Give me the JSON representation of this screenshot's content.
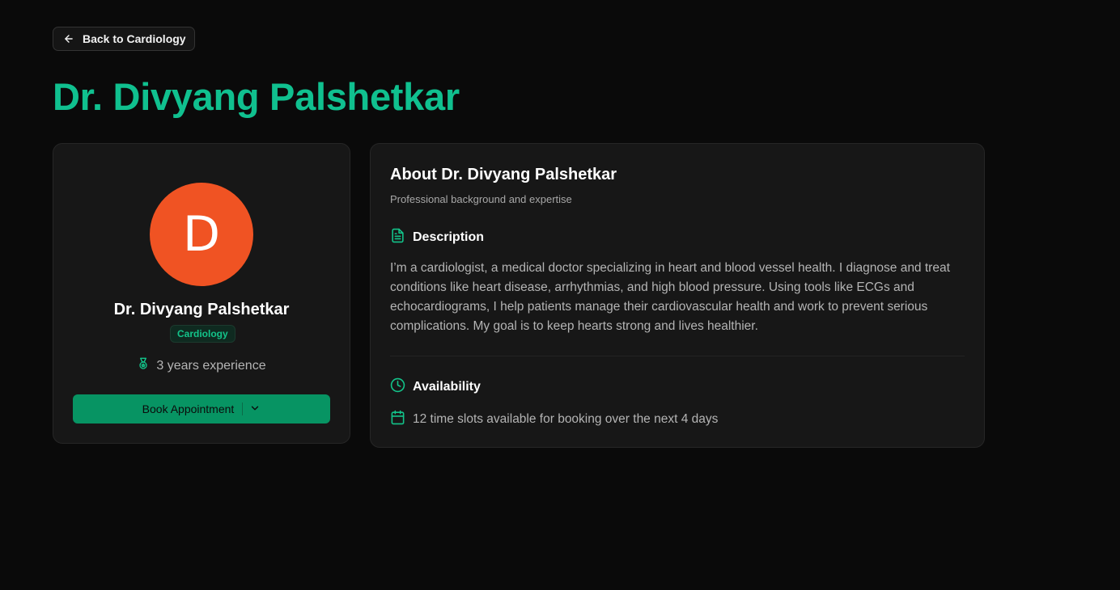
{
  "back_button": {
    "label": "Back to Cardiology",
    "icon": "arrow-left-icon"
  },
  "page_title": "Dr. Divyang Palshetkar",
  "profile": {
    "avatar_initial": "D",
    "avatar_color": "#f05323",
    "name": "Dr. Divyang Palshetkar",
    "specialty": "Cardiology",
    "experience": "3 years experience",
    "experience_icon": "medal-icon",
    "book_button_label": "Book Appointment",
    "book_button_icon": "chevron-down-icon"
  },
  "about": {
    "title": "About Dr. Divyang Palshetkar",
    "subtitle": "Professional background and expertise",
    "description_heading": "Description",
    "description_icon": "document-icon",
    "description_text": "I’m a cardiologist, a medical doctor specializing in heart and blood vessel health. I diagnose and treat conditions like heart disease, arrhythmias, and high blood pressure. Using tools like ECGs and echocardiograms, I help patients manage their cardiovascular health and work to prevent serious complications. My goal is to keep hearts strong and lives healthier.",
    "availability_heading": "Availability",
    "availability_icon": "clock-icon",
    "availability_text": "12 time slots available for booking over the next 4 days",
    "calendar_icon": "calendar-icon"
  },
  "colors": {
    "accent": "#10c08f",
    "button": "#079463",
    "background": "#0a0a0a",
    "card": "#171717"
  }
}
